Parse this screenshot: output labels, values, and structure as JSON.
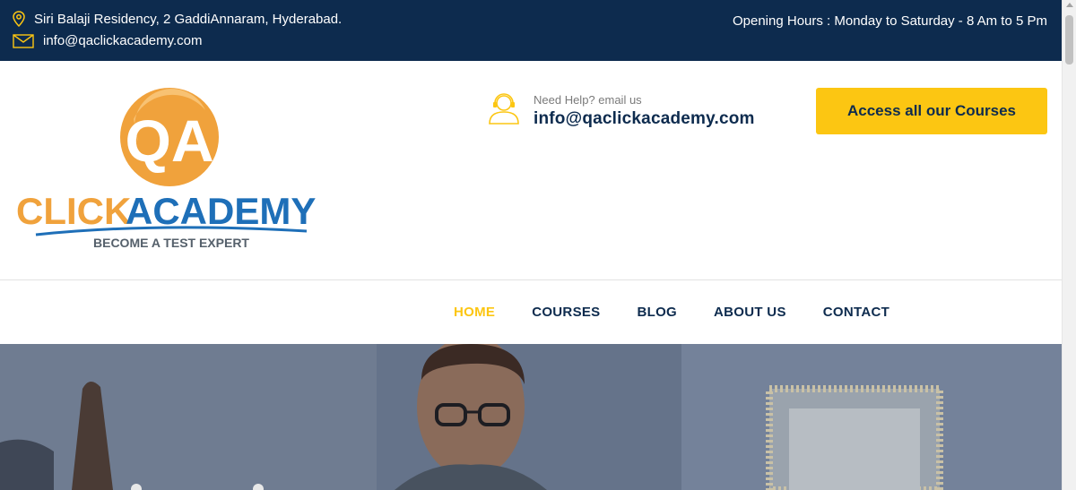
{
  "topbar": {
    "address": "Siri Balaji Residency, 2 GaddiAnnaram, Hyderabad.",
    "email": "info@qaclickacademy.com",
    "hours": "Opening Hours : Monday to Saturday - 8 Am to 5 Pm"
  },
  "logo": {
    "badge": "QA",
    "word_click": "CLICK",
    "word_academy": "ACADEMY",
    "tagline": "BECOME A TEST EXPERT"
  },
  "help": {
    "label": "Need Help? email us",
    "email": "info@qaclickacademy.com"
  },
  "cta": {
    "label": "Access all our Courses"
  },
  "nav": {
    "items": [
      {
        "label": "HOME"
      },
      {
        "label": "COURSES"
      },
      {
        "label": "BLOG"
      },
      {
        "label": "ABOUT US"
      },
      {
        "label": "CONTACT"
      }
    ]
  },
  "colors": {
    "navy": "#0d2b4e",
    "accent": "#fcc612",
    "logo_orange": "#f0a23c",
    "logo_blue": "#1e6fb8"
  }
}
